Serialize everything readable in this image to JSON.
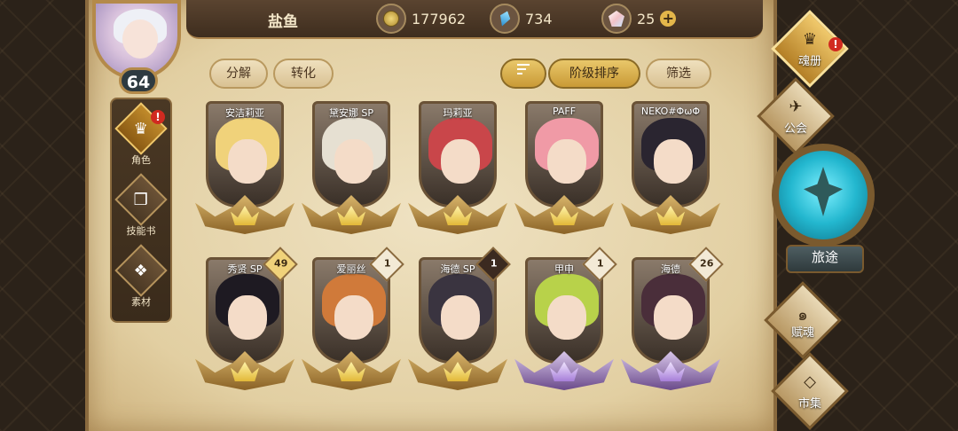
{
  "player": {
    "name": "盐鱼",
    "level": "64"
  },
  "resources": {
    "gold": "177962",
    "crystal": "734",
    "gem": "25",
    "add_symbol": "+"
  },
  "sidebar": {
    "items": [
      {
        "label": "角色",
        "icon": "character-icon",
        "alert": "!"
      },
      {
        "label": "技能书",
        "icon": "skill-book-icon"
      },
      {
        "label": "素材",
        "icon": "material-icon"
      }
    ]
  },
  "actions": {
    "decompose": "分解",
    "convert": "转化",
    "sort_by_rank": "阶级排序",
    "filter": "筛选"
  },
  "cards": [
    {
      "name": "安洁莉亚",
      "level": "",
      "tier": "gold",
      "hair": "#f0d27a"
    },
    {
      "name": "黛安娜 SP",
      "level": "",
      "tier": "gold",
      "hair": "#e6e0d2"
    },
    {
      "name": "玛莉亚",
      "level": "",
      "tier": "gold",
      "hair": "#c9464a"
    },
    {
      "name": "PAFF",
      "level": "",
      "tier": "gold",
      "hair": "#f09aa6"
    },
    {
      "name": "NEKO#ΦωΦ",
      "level": "",
      "tier": "gold",
      "hair": "#2a2530"
    },
    {
      "name": "秀贤 SP",
      "level": "49",
      "tier": "gold",
      "hair": "#1e1a22"
    },
    {
      "name": "爱丽丝",
      "level": "1",
      "tier": "gold",
      "hair": "#d07a3a"
    },
    {
      "name": "海德 SP",
      "level": "1",
      "tier": "gold",
      "hair": "#3a3440"
    },
    {
      "name": "甲申",
      "level": "1",
      "tier": "purple",
      "hair": "#b8d24a"
    },
    {
      "name": "海德",
      "level": "26",
      "tier": "purple",
      "hair": "#4a2e3a"
    }
  ],
  "right_nav": {
    "soul_book": "魂册",
    "guild": "公会",
    "journey": "旅途",
    "bestow": "赋魂",
    "market": "市集",
    "alert": "!"
  },
  "colors": {
    "gold_tier": "#e2b838",
    "purple_tier": "#a67ed8",
    "alert": "#d12a20",
    "journey_orb": "#23b7cf"
  }
}
